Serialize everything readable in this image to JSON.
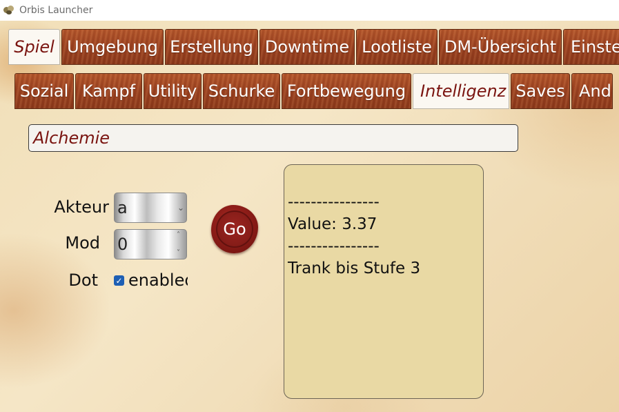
{
  "window": {
    "title": "Orbis Launcher"
  },
  "main_tabs": [
    {
      "label": "Spiel",
      "active": true
    },
    {
      "label": "Umgebung"
    },
    {
      "label": "Erstellung"
    },
    {
      "label": "Downtime"
    },
    {
      "label": "Lootliste"
    },
    {
      "label": "DM-Übersicht"
    },
    {
      "label": "Einstellungen"
    }
  ],
  "sub_tabs": [
    {
      "label": "Sozial"
    },
    {
      "label": "Kampf"
    },
    {
      "label": "Utility"
    },
    {
      "label": "Schurke"
    },
    {
      "label": "Fortbewegung"
    },
    {
      "label": "Intelligenz",
      "active": true
    },
    {
      "label": "Saves"
    },
    {
      "label": "Andere"
    }
  ],
  "spell": {
    "value": "Alchemie"
  },
  "form": {
    "akteur_label": "Akteur",
    "akteur_value": "a",
    "mod_label": "Mod",
    "mod_value": "0",
    "dot_label": "Dot",
    "dot_checkbox_label": "enabled",
    "dot_checked": true
  },
  "go_button": {
    "label": "Go"
  },
  "output": {
    "lines": [
      "----------------",
      "Value: 3.37",
      "----------------",
      "Trank bis Stufe 3"
    ]
  },
  "colors": {
    "tab_wood": "#9b4120",
    "active_tab_text": "#7a1410",
    "output_bg": "#e9d9a4",
    "seal_red": "#8e1d18",
    "checkbox_blue": "#1e5fb4"
  }
}
